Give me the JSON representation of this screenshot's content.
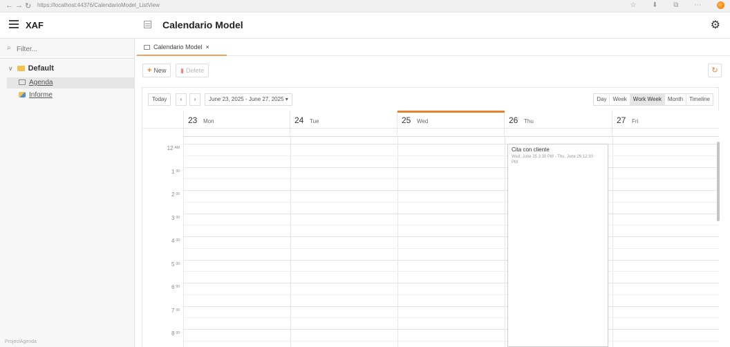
{
  "browser": {
    "url": "https://localhost:44376/CalendarioModel_ListView"
  },
  "app": {
    "brand": "XAF",
    "view_title": "Calendario Model"
  },
  "sidebar": {
    "filter_placeholder": "Filter...",
    "group": "Default",
    "items": [
      {
        "label": "Agenda",
        "selected": true
      },
      {
        "label": "Informe",
        "selected": false
      }
    ],
    "footer": "ProjectAgenda"
  },
  "doc_tab": {
    "label": "Calendario Model",
    "close": "×"
  },
  "toolbar": {
    "new_label": "New",
    "delete_label": "Delete"
  },
  "scheduler": {
    "today_label": "Today",
    "prev": "‹",
    "next": "›",
    "date_range": "June 23, 2025 - June 27, 2025",
    "views": [
      "Day",
      "Week",
      "Work Week",
      "Month",
      "Timeline"
    ],
    "active_view": "Work Week",
    "days": [
      {
        "num": "23",
        "dow": "Mon"
      },
      {
        "num": "24",
        "dow": "Tue"
      },
      {
        "num": "25",
        "dow": "Wed",
        "today": true
      },
      {
        "num": "26",
        "dow": "Thu"
      },
      {
        "num": "27",
        "dow": "Fri"
      }
    ],
    "hours": [
      {
        "h": "12",
        "ap": "AM"
      },
      {
        "h": "1",
        "ap": "00"
      },
      {
        "h": "2",
        "ap": "00"
      },
      {
        "h": "3",
        "ap": "00"
      },
      {
        "h": "4",
        "ap": "00"
      },
      {
        "h": "5",
        "ap": "00"
      },
      {
        "h": "6",
        "ap": "00"
      },
      {
        "h": "7",
        "ap": "00"
      },
      {
        "h": "8",
        "ap": "00"
      }
    ],
    "appointment": {
      "title": "Cita con cliente",
      "time": "Wed, June 25 3:30 PM - Thu, June 26 12:30 PM"
    }
  },
  "colors": {
    "accent": "#e8802f",
    "folder": "#f3c34e"
  },
  "icons": [
    "hamburger-icon",
    "calendar-icon",
    "gear-icon",
    "search-icon",
    "folder-icon",
    "report-icon",
    "plus-icon",
    "trash-icon",
    "refresh-icon"
  ]
}
